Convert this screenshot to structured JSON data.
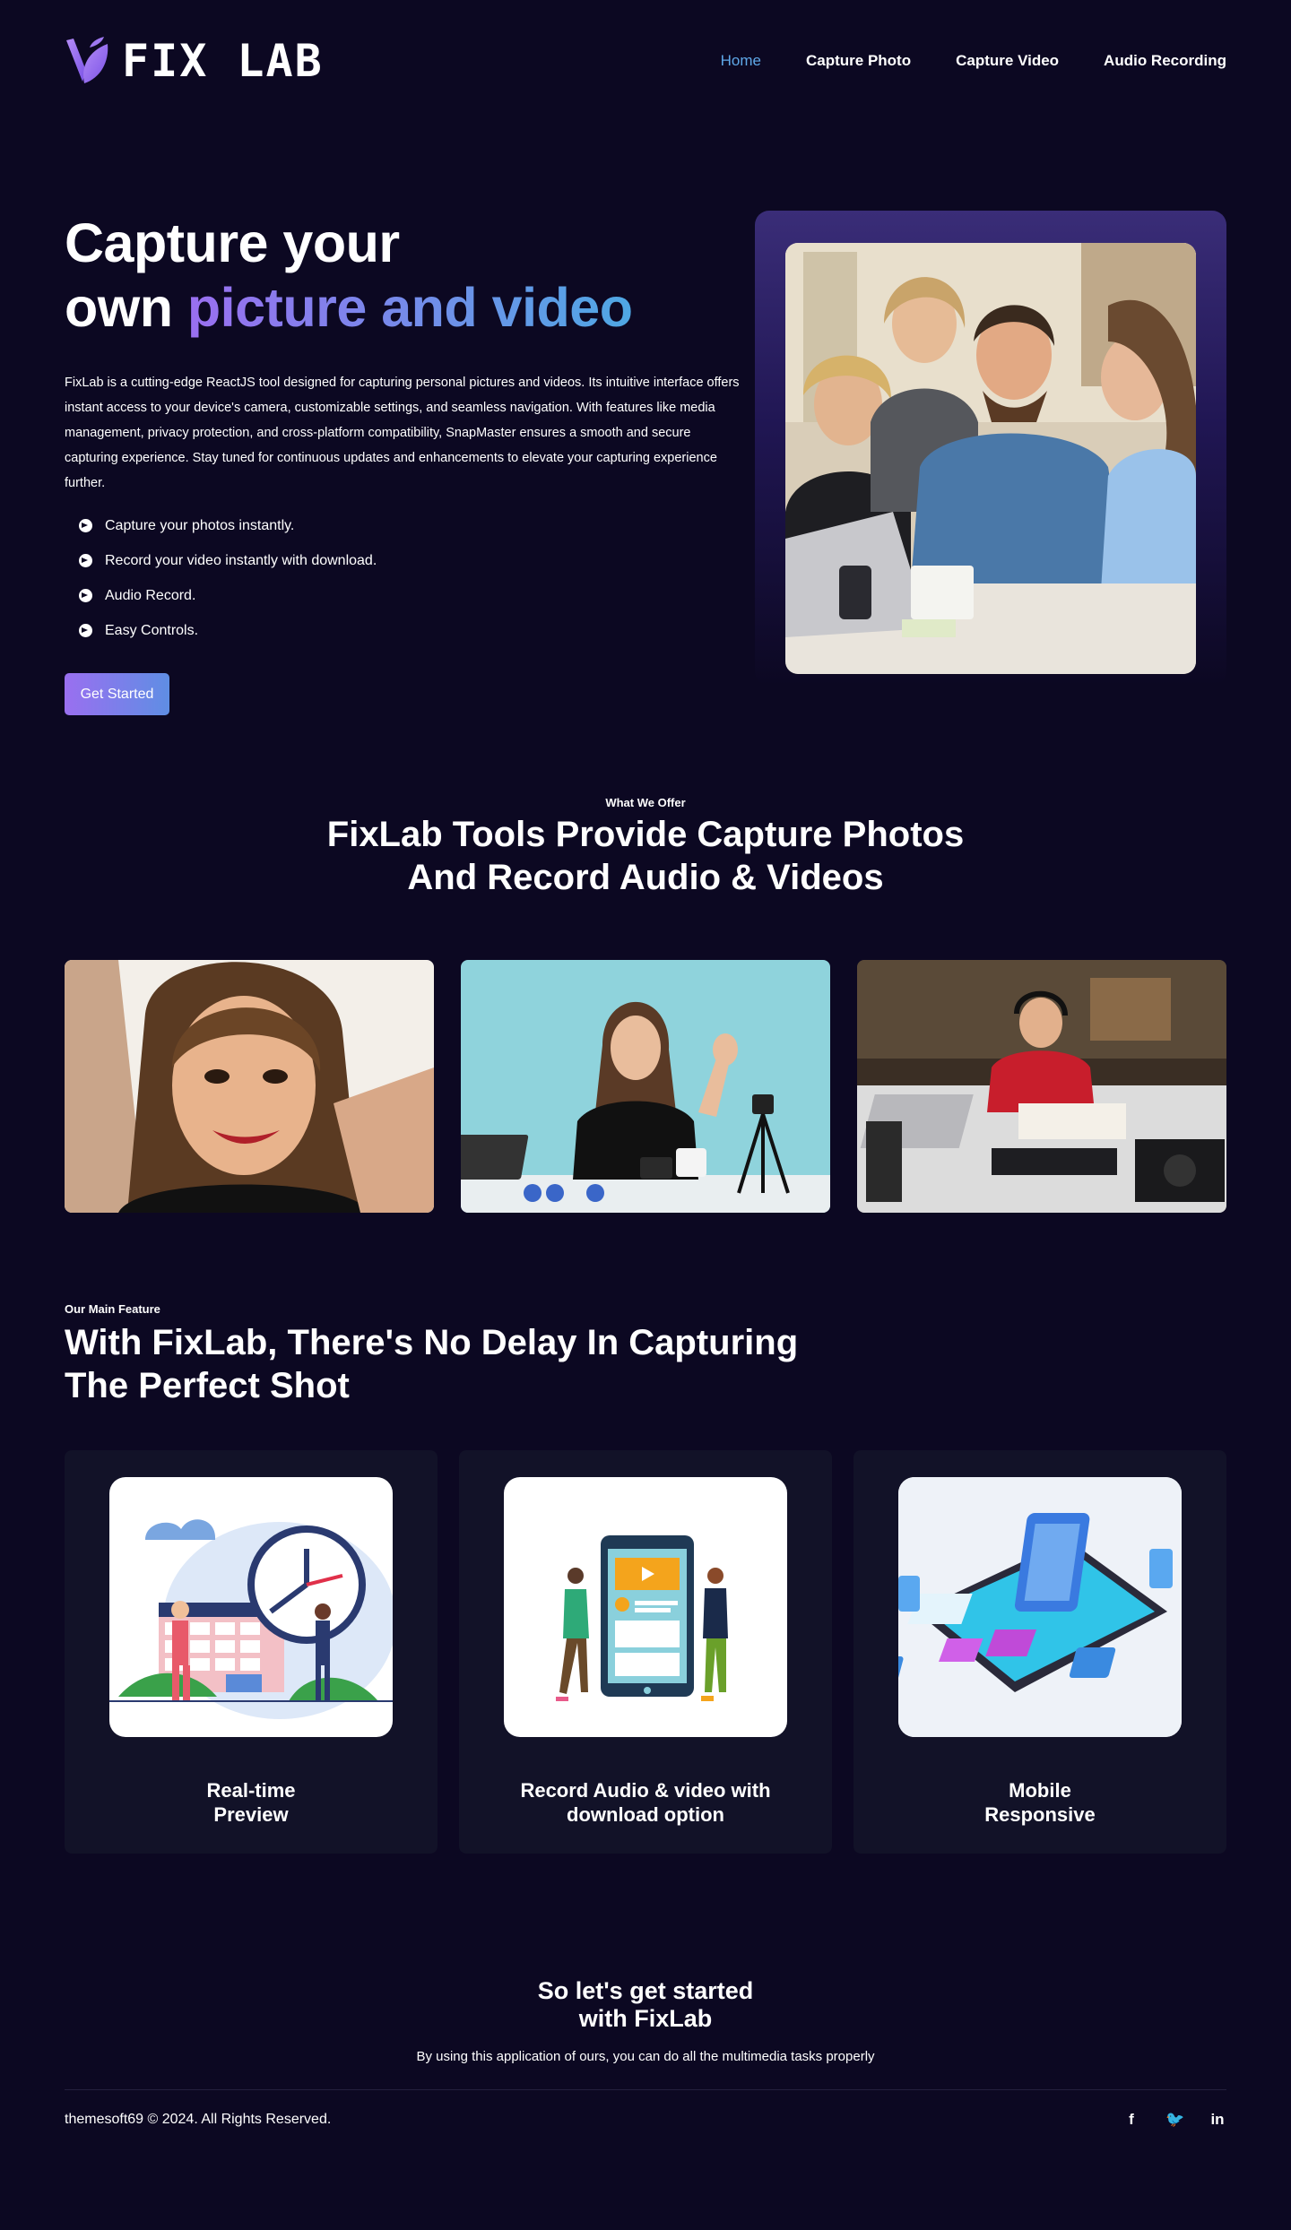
{
  "header": {
    "logo_text": "FIX LAB",
    "nav": [
      {
        "label": "Home",
        "active": true
      },
      {
        "label": "Capture Photo",
        "active": false
      },
      {
        "label": "Capture Video",
        "active": false
      },
      {
        "label": "Audio Recording",
        "active": false
      }
    ]
  },
  "hero": {
    "title_line1": "Capture your",
    "title_line2_plain": "own ",
    "title_line2_gradient": "picture and video",
    "description": "FixLab is a cutting-edge ReactJS tool designed for capturing personal pictures and videos. Its intuitive interface offers instant access to your device's camera, customizable settings, and seamless navigation. With features like media management, privacy protection, and cross-platform compatibility, SnapMaster ensures a smooth and secure capturing experience. Stay tuned for continuous updates and enhancements to elevate your capturing experience further.",
    "features": [
      "Capture your photos instantly.",
      "Record your video instantly with download.",
      "Audio Record.",
      "Easy Controls."
    ],
    "cta_label": "Get Started"
  },
  "offer": {
    "eyebrow": "What We Offer",
    "title_line1": "FixLab Tools Provide Capture Photos",
    "title_line2": "And Record Audio & Videos"
  },
  "main_feature": {
    "eyebrow": "Our Main Feature",
    "title_line1": "With FixLab, There's No Delay In Capturing",
    "title_line2": "The Perfect Shot",
    "cards": [
      {
        "line1": "Real-time",
        "line2": "Preview"
      },
      {
        "line1": "Record Audio & video with",
        "line2": "download option"
      },
      {
        "line1": "Mobile",
        "line2": "Responsive"
      }
    ]
  },
  "cta": {
    "title_line1": "So let's get started",
    "title_line2": "with FixLab",
    "subtitle": "By using this application of ours, you can do all the multimedia tasks properly"
  },
  "footer": {
    "copyright": "themesoft69 © 2024. All Rights Reserved.",
    "social": [
      {
        "icon": "facebook-icon",
        "glyph": "f"
      },
      {
        "icon": "twitter-icon",
        "glyph": "🐦"
      },
      {
        "icon": "linkedin-icon",
        "glyph": "in"
      }
    ]
  },
  "colors": {
    "background": "#0c0822",
    "nav_active": "#5fa8e8",
    "gradient_start": "#9a6ff0",
    "gradient_end": "#4fa8e4",
    "card_bg": "#121228"
  }
}
